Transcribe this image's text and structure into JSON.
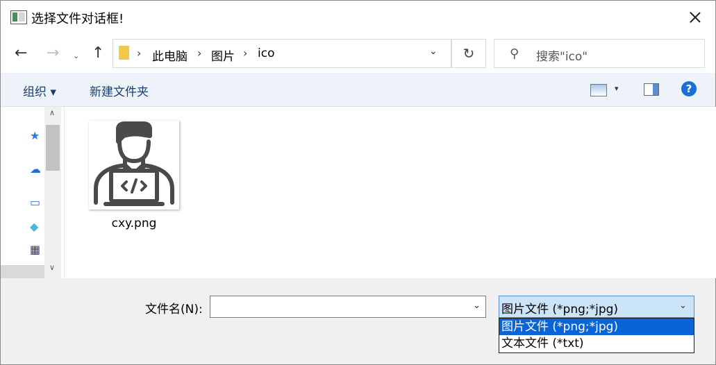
{
  "window": {
    "title": "选择文件对话框!"
  },
  "nav": {
    "back_icon": "←",
    "forward_icon": "→",
    "recent_icon": "⌄",
    "up_icon": "↑",
    "breadcrumbs": [
      "此电脑",
      "图片",
      "ico"
    ],
    "separator": "›",
    "dropdown_icon": "⌄",
    "refresh_icon": "↻",
    "search_placeholder": "搜索\"ico\""
  },
  "toolbar": {
    "organize": "组织 ▾",
    "new_folder": "新建文件夹",
    "view_drop": "▾",
    "help": "?"
  },
  "sidebar": {
    "icons": [
      "quick-access-star",
      "onedrive-cloud",
      "this-pc",
      "3d-objects",
      "videos"
    ],
    "scroll_up": "∧",
    "scroll_down": "∨"
  },
  "files": [
    {
      "name": "cxy.png",
      "icon": "developer-laptop-thumbnail"
    }
  ],
  "footer": {
    "filename_label": "文件名(N):",
    "filename_value": "",
    "filetype_selected": "图片文件 (*png;*jpg)",
    "filetype_options": [
      "图片文件 (*png;*jpg)",
      "文本文件 (*txt)"
    ],
    "dropdown_icon": "⌄"
  },
  "colors": {
    "accent": "#0b64d6",
    "select_bg": "#cce4f7",
    "toolbar_text": "#1a3e6f"
  }
}
